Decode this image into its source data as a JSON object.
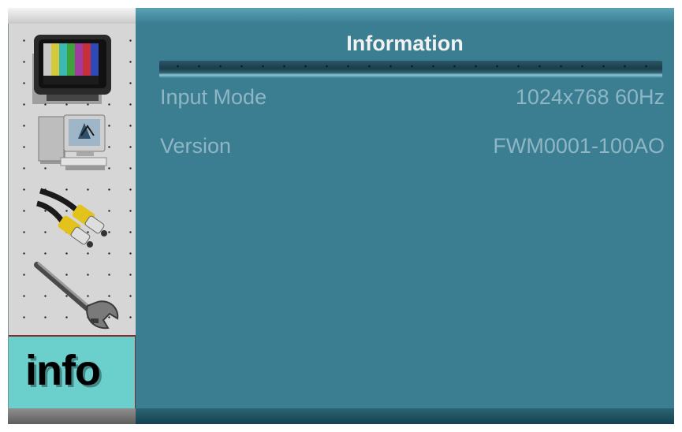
{
  "sidebar": {
    "items": [
      {
        "icon": "tv-color-bars-icon"
      },
      {
        "icon": "computer-icon"
      },
      {
        "icon": "av-cables-icon"
      },
      {
        "icon": "wrench-icon"
      },
      {
        "icon": "info-icon",
        "label": "info",
        "selected": true
      }
    ]
  },
  "panel": {
    "title": "Information",
    "rows": [
      {
        "label": "Input Mode",
        "value": "1024x768 60Hz"
      },
      {
        "label": "Version",
        "value": "FWM0001-100AO"
      }
    ]
  },
  "colors": {
    "panel_bg": "#3b7e92",
    "text_dim": "#8eb6c4",
    "title_text": "#f2f2f2",
    "selected_item_bg": "#6bd0cc",
    "sidebar_bg": "#d6d6d6"
  }
}
